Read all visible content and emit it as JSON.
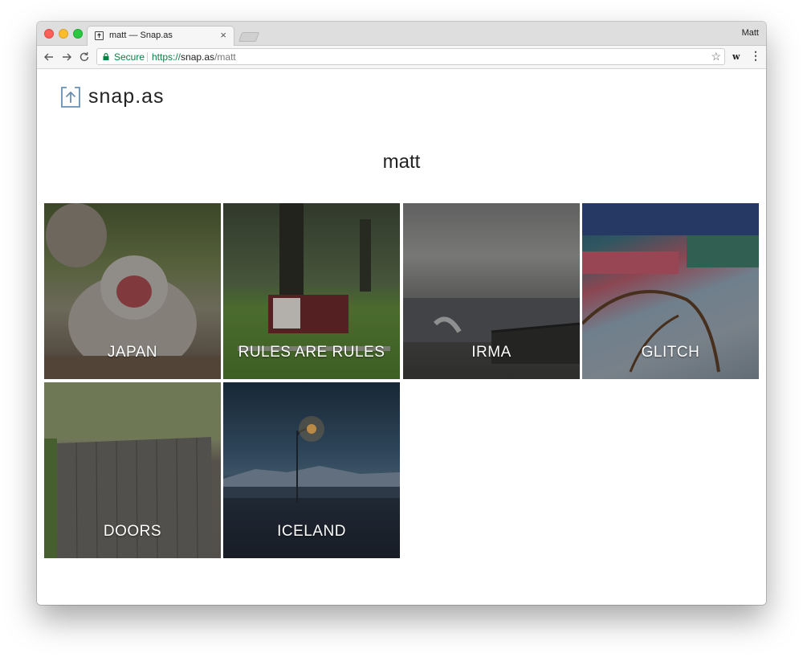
{
  "browser": {
    "tab_title": "matt — Snap.as",
    "tab_close": "×",
    "profile_name": "Matt",
    "secure_label": "Secure",
    "url_scheme": "https://",
    "url_host": "snap.as",
    "url_path": "/matt",
    "extension_label": "w"
  },
  "site": {
    "logo_text": "snap.as",
    "user_title": "matt"
  },
  "albums": [
    {
      "label": "JAPAN"
    },
    {
      "label": "RULES ARE RULES"
    },
    {
      "label": "IRMA"
    },
    {
      "label": "GLITCH"
    },
    {
      "label": "DOORS"
    },
    {
      "label": "ICELAND"
    }
  ],
  "colors": {
    "secure_green": "#0b8043",
    "logo_blue": "#6a8fb5"
  }
}
